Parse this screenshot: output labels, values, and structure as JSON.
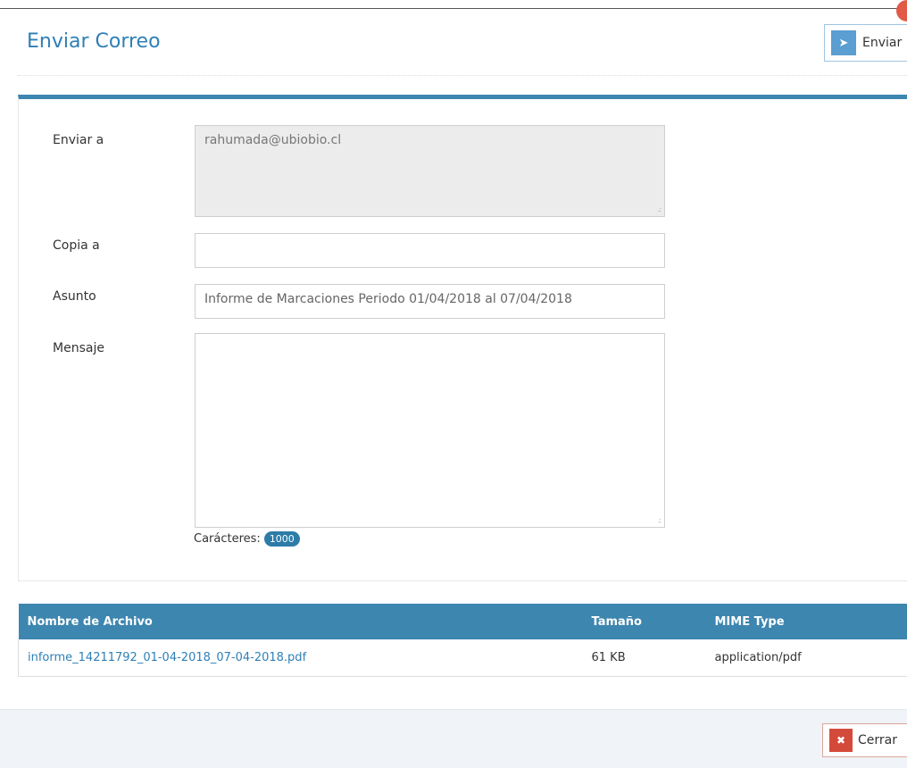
{
  "header": {
    "title": "Enviar Correo",
    "send_button_label": "Enviar",
    "send_icon": "paper-plane-icon"
  },
  "form": {
    "to_label": "Enviar a",
    "to_value": "rahumada@ubiobio.cl",
    "cc_label": "Copia a",
    "cc_value": "",
    "subject_label": "Asunto",
    "subject_value": "Informe de Marcaciones Periodo 01/04/2018 al 07/04/2018",
    "message_label": "Mensaje",
    "message_value": "",
    "chars_label": "Carácteres:",
    "chars_count": "1000"
  },
  "attachments": {
    "columns": [
      "Nombre de Archivo",
      "Tamaño",
      "MIME Type"
    ],
    "rows": [
      [
        "informe_14211792_01-04-2018_07-04-2018.pdf",
        "61 KB",
        "application/pdf"
      ]
    ]
  },
  "footer": {
    "close_button_label": "Cerrar",
    "close_icon": "close-icon"
  },
  "colors": {
    "primary": "#2f7fb6",
    "table_header": "#3d86b0",
    "danger": "#d44a3a"
  }
}
